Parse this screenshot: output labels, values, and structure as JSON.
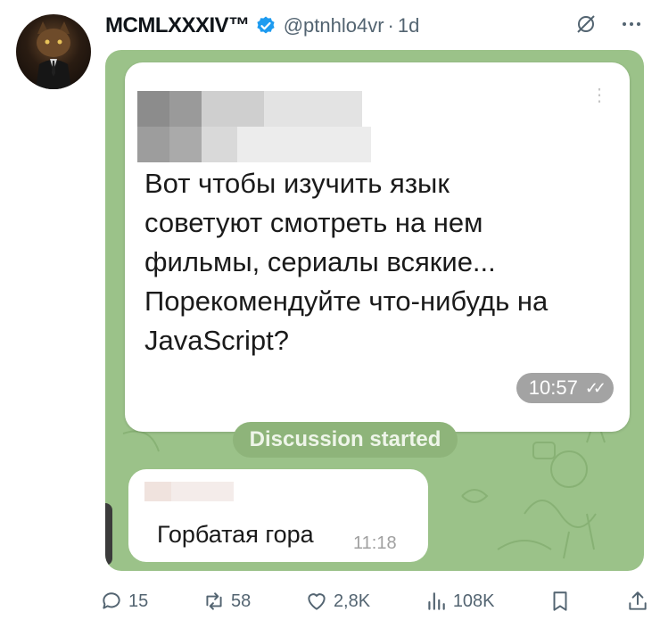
{
  "tweet": {
    "display_name": "MCMLXXXIV™",
    "handle": "@ptnhlo4vr",
    "separator": "·",
    "time": "1d",
    "verified": true,
    "accent_color": "#1d9bf0"
  },
  "media": {
    "message_lines": [
      "Вот чтобы изучить язык",
      "советуют смотреть на нем",
      "фильмы, сериалы всякие...",
      "Порекомендуйте что-нибудь на",
      "JavaScript?"
    ],
    "message_time": "10:57",
    "system_pill": "Discussion started",
    "reply_text": "Горбатая гора",
    "reply_time": "11:18"
  },
  "actions": {
    "replies": "15",
    "reposts": "58",
    "likes": "2,8K",
    "views": "108K"
  },
  "icons": [
    "grok-icon",
    "more-icon",
    "reply-icon",
    "repost-icon",
    "like-icon",
    "views-icon",
    "bookmark-icon",
    "share-icon"
  ]
}
